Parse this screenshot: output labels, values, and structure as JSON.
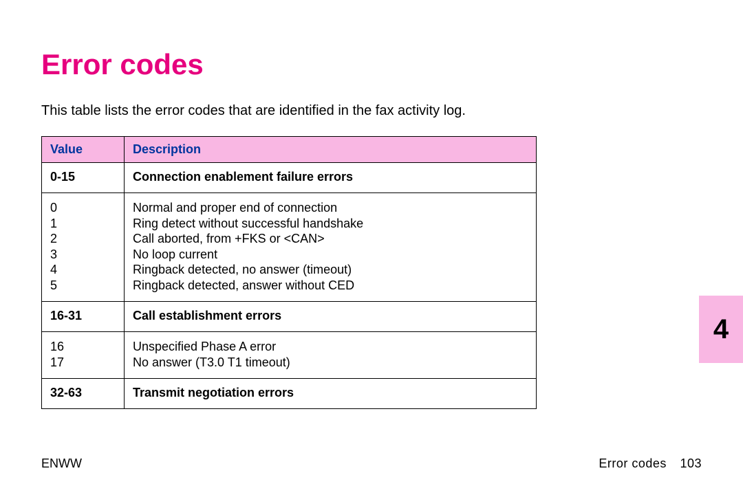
{
  "title": "Error codes",
  "intro": "This table lists the error codes that are identified in the fax activity log.",
  "table": {
    "headers": {
      "value": "Value",
      "description": "Description"
    },
    "section1": {
      "range": "0-15",
      "title": "Connection enablement failure errors",
      "codes": "0\n1\n2\n3\n4\n5",
      "descs": "Normal and proper end of connection\nRing detect without successful handshake\nCall aborted, from +FKS or <CAN>\nNo loop current\nRingback detected, no answer (timeout)\nRingback detected, answer without CED"
    },
    "section2": {
      "range": "16-31",
      "title": "Call establishment errors",
      "codes": "16\n17",
      "descs": "Unspecified Phase A error\nNo answer (T3.0 T1 timeout)"
    },
    "section3": {
      "range": "32-63",
      "title": "Transmit negotiation errors"
    }
  },
  "sideTab": "4",
  "footer": {
    "left": "ENWW",
    "rightLabel": "Error codes",
    "pageNumber": "103"
  },
  "chart_data": {
    "type": "table",
    "columns": [
      "Value",
      "Description"
    ],
    "sections": [
      {
        "range": "0-15",
        "title": "Connection enablement failure errors",
        "rows": [
          {
            "value": 0,
            "description": "Normal and proper end of connection"
          },
          {
            "value": 1,
            "description": "Ring detect without successful handshake"
          },
          {
            "value": 2,
            "description": "Call aborted, from +FKS or <CAN>"
          },
          {
            "value": 3,
            "description": "No loop current"
          },
          {
            "value": 4,
            "description": "Ringback detected, no answer (timeout)"
          },
          {
            "value": 5,
            "description": "Ringback detected, answer without CED"
          }
        ]
      },
      {
        "range": "16-31",
        "title": "Call establishment errors",
        "rows": [
          {
            "value": 16,
            "description": "Unspecified Phase A error"
          },
          {
            "value": 17,
            "description": "No answer (T3.0 T1 timeout)"
          }
        ]
      },
      {
        "range": "32-63",
        "title": "Transmit negotiation errors",
        "rows": []
      }
    ]
  }
}
